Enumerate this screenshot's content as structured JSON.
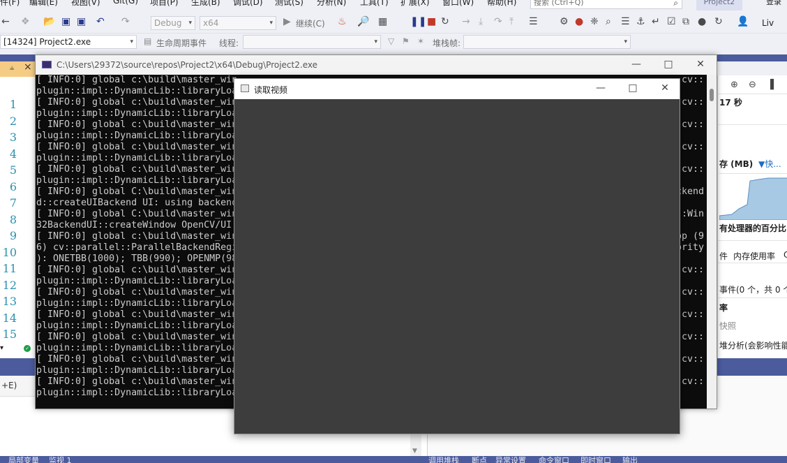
{
  "vs": {
    "menu": [
      "件(F)",
      "编辑(E)",
      "视图(V)",
      "Git(G)",
      "项目(P)",
      "生成(B)",
      "调试(D)",
      "测试(S)",
      "分析(N)",
      "工具(T)",
      "扩展(X)",
      "窗口(W)",
      "帮助(H)"
    ],
    "search_placeholder": "搜索 (Ctrl+Q)",
    "solution_badge": "Project2",
    "login": "登录",
    "toolbar": {
      "config": "Debug",
      "platform": "x64",
      "continue": "继续(C)",
      "live": "Liv"
    },
    "toolbar2": {
      "process": "[14324] Project2.exe",
      "lifecycle": "生命周期事件",
      "thread_label": "线程:",
      "stackframe_label": "堆栈帧:"
    },
    "editor": {
      "line_numbers": [
        "1",
        "2",
        "3",
        "4",
        "5",
        "6",
        "7",
        "8",
        "9",
        "10",
        "11",
        "12",
        "13",
        "14",
        "15"
      ]
    },
    "output_hint": "+E)",
    "bottom_tabs": [
      "局部变量",
      "监视 1",
      "调用堆栈",
      "断点",
      "异常设置",
      "命令窗口",
      "即时窗口",
      "输出"
    ],
    "diag": {
      "time": "17 秒",
      "memory_label": "存 (MB)",
      "snapshot_label": "▼快...",
      "cpu_label": "有处理器的百分比",
      "tab_events": "件",
      "tab_memory": "内存使用率",
      "tab_more": "C",
      "events": "事件(0 个，共 0 个",
      "rate": "率",
      "snapshot": "快照",
      "heap": "堆分析(会影响性能"
    }
  },
  "console": {
    "title": "C:\\Users\\29372\\source\\repos\\Project2\\x64\\Debug\\Project2.exe",
    "lines": [
      "[ INFO:0] global c:\\build\\master_win",
      "plugin::impl::DynamicLib::libraryLoa",
      "[ INFO:0] global c:\\build\\master_win",
      "plugin::impl::DynamicLib::libraryLoa",
      "[ INFO:0] global c:\\build\\master_win",
      "plugin::impl::DynamicLib::libraryLoa",
      "[ INFO:0] global c:\\build\\master_win",
      "plugin::impl::DynamicLib::libraryLoa",
      "[ INFO:0] global c:\\build\\master_win",
      "plugin::impl::DynamicLib::libraryLoa",
      "[ INFO:0] global C:\\build\\master_win",
      "d::createUIBackend UI: using backend",
      "[ INFO:0] global C:\\build\\master_win",
      "32BackendUI::createWindow OpenCV/UI:",
      "[ INFO:0] global c:\\build\\master_win",
      "6) cv::parallel::ParallelBackendRegi",
      "): ONETBB(1000); TBB(990); OPENMP(98",
      "[ INFO:0] global c:\\build\\master_win",
      "plugin::impl::DynamicLib::libraryLoa",
      "[ INFO:0] global c:\\build\\master_win",
      "plugin::impl::DynamicLib::libraryLoa",
      "[ INFO:0] global c:\\build\\master_win",
      "plugin::impl::DynamicLib::libraryLoa",
      "[ INFO:0] global c:\\build\\master_win",
      "plugin::impl::DynamicLib::libraryLoa",
      "[ INFO:0] global c:\\build\\master_win",
      "plugin::impl::DynamicLib::libraryLoa",
      "[ INFO:0] global c:\\build\\master_win",
      "plugin::impl::DynamicLib::libraryLoa"
    ],
    "right_fragments": [
      {
        "row": 0,
        "text": "cv::"
      },
      {
        "row": 2,
        "text": "cv::"
      },
      {
        "row": 4,
        "text": "cv::"
      },
      {
        "row": 6,
        "text": "cv::"
      },
      {
        "row": 8,
        "text": "cv::"
      },
      {
        "row": 10,
        "text": "ackend"
      },
      {
        "row": 12,
        "text": "::Win"
      },
      {
        "row": 14,
        "text": "op (9"
      },
      {
        "row": 15,
        "text": "ority"
      },
      {
        "row": 17,
        "text": "cv::"
      },
      {
        "row": 19,
        "text": "cv::"
      },
      {
        "row": 21,
        "text": "cv::"
      },
      {
        "row": 23,
        "text": "cv::"
      },
      {
        "row": 25,
        "text": "cv::"
      },
      {
        "row": 27,
        "text": "cv::"
      }
    ]
  },
  "video_window": {
    "title": "读取视频"
  },
  "colors": {
    "vs_accent": "#4b5b9c",
    "console_bg": "#0c0c0c",
    "console_text": "#cccccc",
    "video_bg": "#3e3d3e",
    "editor_tab": "#f5cc84"
  }
}
